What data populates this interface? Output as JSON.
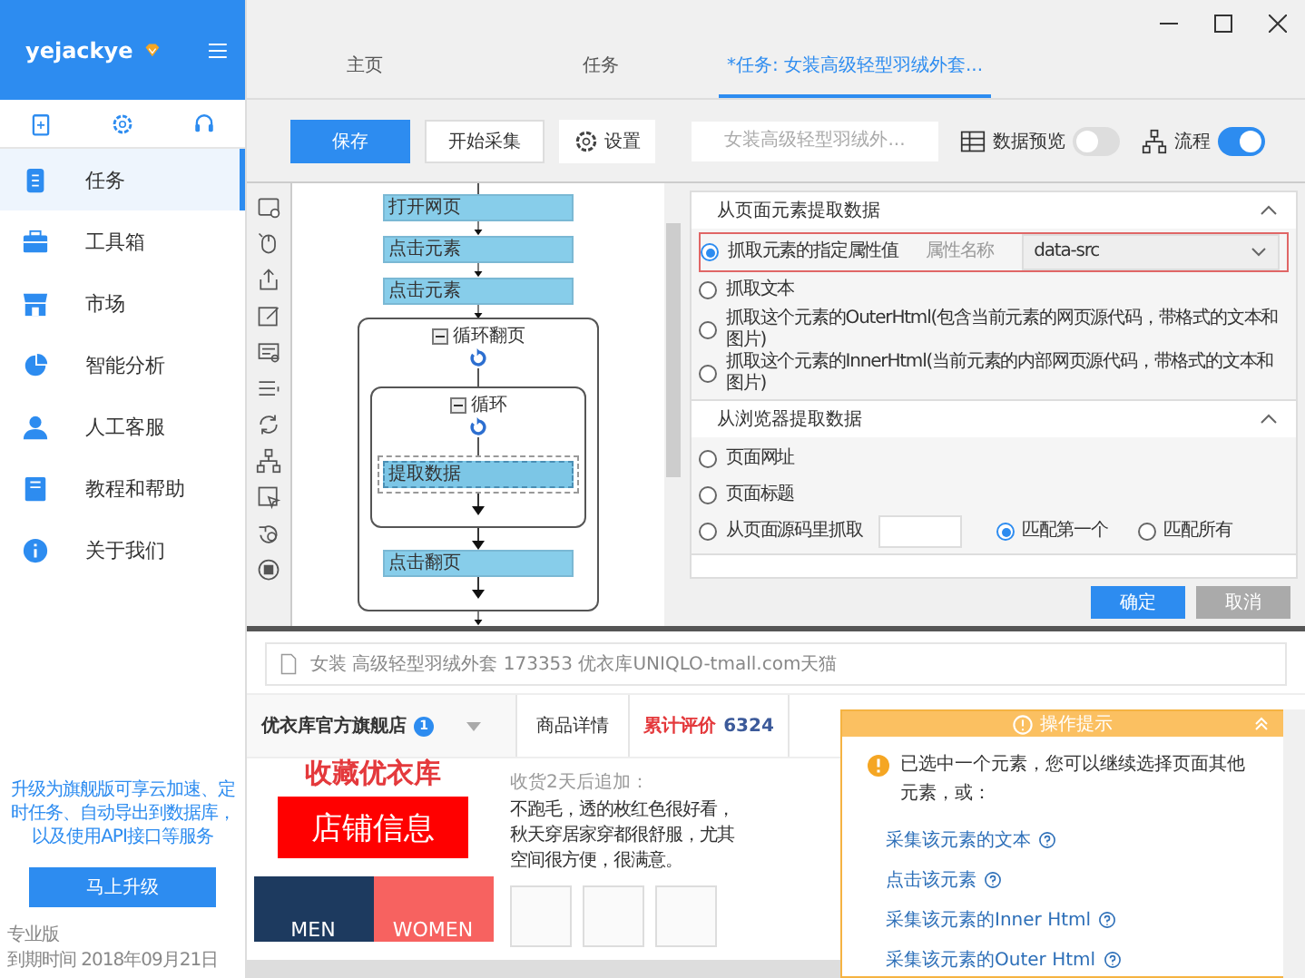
{
  "app": {
    "username": "yejackye"
  },
  "sidebar": {
    "items": [
      {
        "label": "任务",
        "selected": true
      },
      {
        "label": "工具箱",
        "selected": false
      },
      {
        "label": "市场",
        "selected": false
      },
      {
        "label": "智能分析",
        "selected": false
      },
      {
        "label": "人工客服",
        "selected": false
      },
      {
        "label": "教程和帮助",
        "selected": false
      },
      {
        "label": "关于我们",
        "selected": false
      }
    ],
    "promo": "升级为旗舰版可享云加速、定时任务、自动导出到数据库，以及使用API接口等服务",
    "upgrade_button": "马上升级",
    "edition": "专业版",
    "expiry": "到期时间 2018年09月21日"
  },
  "tabs": [
    {
      "label": "主页",
      "selected": false
    },
    {
      "label": "任务",
      "selected": false
    },
    {
      "label": "*任务: 女装高级轻型羽绒外套...",
      "selected": true
    }
  ],
  "toolbar": {
    "save": "保存",
    "start": "开始采集",
    "settings": "设置",
    "search": {
      "placeholder": "女装高级轻型羽绒外..."
    },
    "toggles": [
      {
        "label": "数据预览",
        "on": false
      },
      {
        "label": "流程",
        "on": true
      }
    ]
  },
  "workflow": {
    "steps": [
      {
        "kind": "action",
        "label": "打开网页",
        "selected": false
      },
      {
        "kind": "action",
        "label": "点击元素",
        "selected": false
      },
      {
        "kind": "action",
        "label": "点击元素",
        "selected": false
      },
      {
        "kind": "loop",
        "label": "循环翻页",
        "expanded": true,
        "children": [
          {
            "kind": "loop",
            "label": "循环",
            "expanded": true,
            "children": [
              {
                "kind": "action",
                "label": "提取数据",
                "selected": true
              }
            ]
          },
          {
            "kind": "action",
            "label": "点击翻页",
            "selected": false
          }
        ]
      }
    ]
  },
  "extract_panel": {
    "sections": [
      {
        "title": "从页面元素提取数据",
        "expanded": true,
        "options": [
          {
            "kind": "attribute",
            "label": "抓取元素的指定属性值",
            "selected": true,
            "field_label": "属性名称",
            "value": "data-src"
          },
          {
            "kind": "plain",
            "label": "抓取文本",
            "selected": false
          },
          {
            "kind": "plain",
            "label": "抓取这个元素的OuterHtml(包含当前元素的网页源代码，带格式的文本和图片)",
            "selected": false
          },
          {
            "kind": "plain",
            "label": "抓取这个元素的InnerHtml(当前元素的内部网页源代码，带格式的文本和图片)",
            "selected": false
          }
        ]
      },
      {
        "title": "从浏览器提取数据",
        "expanded": true,
        "options": [
          {
            "kind": "plain",
            "label": "页面网址",
            "selected": false
          },
          {
            "kind": "plain",
            "label": "页面标题",
            "selected": false
          },
          {
            "kind": "source",
            "label": "从页面源码里抓取",
            "selected": false,
            "match_options": [
              {
                "label": "匹配第一个",
                "selected": true
              },
              {
                "label": "匹配所有",
                "selected": false
              }
            ]
          }
        ]
      }
    ],
    "buttons": [
      {
        "label": "确定",
        "disabled": false
      },
      {
        "label": "取消",
        "disabled": true
      }
    ]
  },
  "browser": {
    "address": "女装 高级轻型羽绒外套 173353 优衣库UNIQLO-tmall.com天猫",
    "store": {
      "name": "优衣库官方旗舰店",
      "badge": "1"
    },
    "tabs": [
      {
        "label": "商品详情",
        "selected": false
      },
      {
        "label": "累计评价",
        "count": "6324",
        "selected": true
      }
    ],
    "favorite": "收藏优衣库",
    "shop_info": "店铺信息",
    "categories": [
      "MEN",
      "WOMEN"
    ],
    "review": {
      "label": "收货2天后追加：",
      "lines": [
        "不跑毛，透的枚红色很好看，",
        "秋天穿居家穿都很舒服，尤其",
        "空间很方便，很满意。"
      ]
    }
  },
  "tip_popup": {
    "title": "操作提示",
    "message": "已选中一个元素，您可以继续选择页面其他元素，或：",
    "actions": [
      "采集该元素的文本",
      "点击该元素",
      "采集该元素的Inner Html",
      "采集该元素的Outer Html"
    ]
  }
}
